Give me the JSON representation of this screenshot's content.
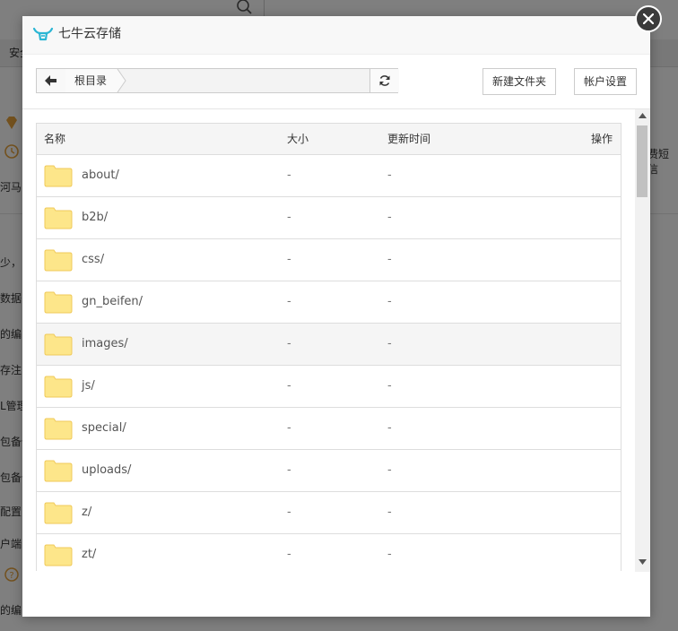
{
  "background": {
    "tab_label": "安全",
    "fragments": [
      "河马",
      "少，",
      "数据",
      "的编",
      "存注",
      "L管理",
      "包备份",
      "包备份",
      "配置D",
      "户端",
      "的编"
    ],
    "right_fragment": "费短信"
  },
  "modal": {
    "title": "七牛云存储",
    "toolbar": {
      "breadcrumb_root": "根目录",
      "new_folder_label": "新建文件夹",
      "account_settings_label": "帐户设置"
    },
    "table": {
      "headers": {
        "name": "名称",
        "size": "大小",
        "updated": "更新时间",
        "actions": "操作"
      },
      "rows": [
        {
          "name": "about/",
          "size": "-",
          "updated": "-"
        },
        {
          "name": "b2b/",
          "size": "-",
          "updated": "-"
        },
        {
          "name": "css/",
          "size": "-",
          "updated": "-"
        },
        {
          "name": "gn_beifen/",
          "size": "-",
          "updated": "-"
        },
        {
          "name": "images/",
          "size": "-",
          "updated": "-"
        },
        {
          "name": "js/",
          "size": "-",
          "updated": "-"
        },
        {
          "name": "special/",
          "size": "-",
          "updated": "-"
        },
        {
          "name": "uploads/",
          "size": "-",
          "updated": "-"
        },
        {
          "name": "z/",
          "size": "-",
          "updated": "-"
        },
        {
          "name": "zt/",
          "size": "-",
          "updated": "-"
        }
      ]
    }
  },
  "icons": {
    "logo": "qiniu-logo-icon",
    "close": "close-icon",
    "back": "arrow-left-icon",
    "refresh": "refresh-icon",
    "folder": "folder-icon"
  },
  "colors": {
    "logo": "#2bb6d4",
    "folder": "#fde68a",
    "folder_stroke": "#f0c95a",
    "close_bg": "#3b3b3b"
  }
}
